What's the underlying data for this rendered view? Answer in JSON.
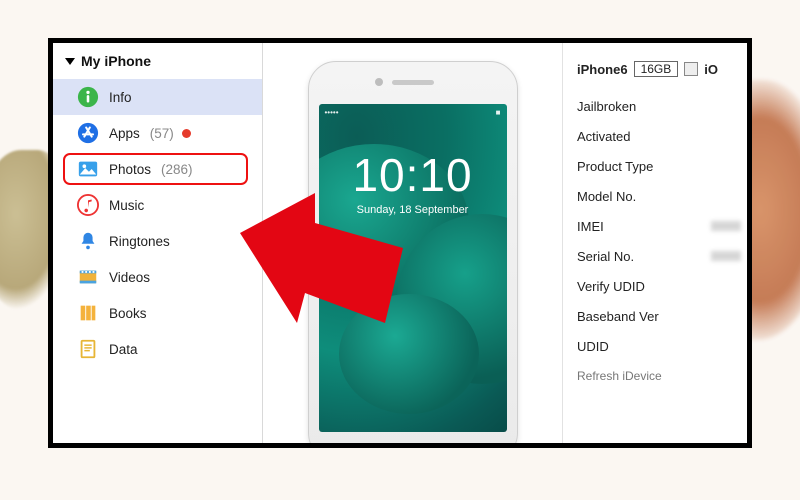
{
  "sidebar": {
    "header": "My iPhone",
    "items": [
      {
        "label": "Info",
        "count": ""
      },
      {
        "label": "Apps",
        "count": "(57)"
      },
      {
        "label": "Photos",
        "count": "(286)"
      },
      {
        "label": "Music",
        "count": ""
      },
      {
        "label": "Ringtones",
        "count": ""
      },
      {
        "label": "Videos",
        "count": ""
      },
      {
        "label": "Books",
        "count": ""
      },
      {
        "label": "Data",
        "count": ""
      }
    ]
  },
  "phone": {
    "time": "10:10",
    "date": "Sunday, 18 September",
    "status_left": "•••••",
    "status_right": "■"
  },
  "info_panel": {
    "model": "iPhone6",
    "capacity": "16GB",
    "os_prefix": "iO",
    "specs": [
      "Jailbroken",
      "Activated",
      "Product Type",
      "Model No.",
      "IMEI",
      "Serial No.",
      "Verify UDID",
      "Baseband Ver",
      "UDID"
    ],
    "refresh": "Refresh iDevice"
  }
}
